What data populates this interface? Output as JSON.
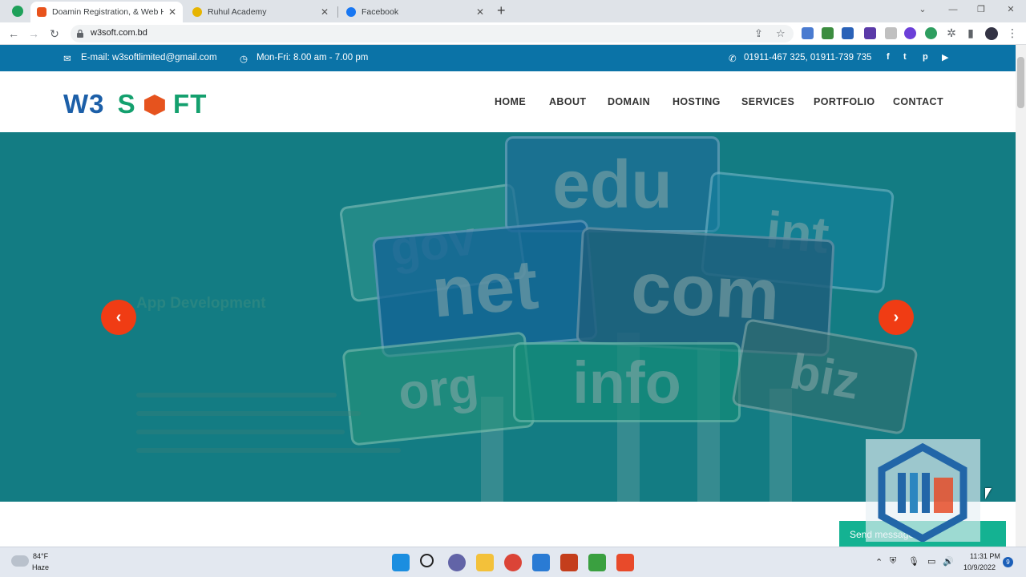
{
  "browser": {
    "tabs": [
      {
        "label": "Doamin Registration, & Web Ho",
        "active": true
      },
      {
        "label": "Ruhul Academy",
        "active": false
      },
      {
        "label": "Facebook",
        "active": false
      }
    ],
    "new_tab": "+",
    "close_glyph": "✕",
    "url": "w3soft.com.bd",
    "window_controls": [
      "⌄",
      "—",
      "❐",
      "✕"
    ]
  },
  "topbar": {
    "email": "E-mail: w3softlimited@gmail.com",
    "hours": "Mon-Fri: 8.00 am - 7.00 pm",
    "phone": "01911-467 325, 01911-739 735",
    "social": [
      "f",
      "t",
      "p",
      "▶"
    ]
  },
  "logo": {
    "part1": "W3",
    "part2": "S",
    "part3": "FT"
  },
  "nav": [
    "HOME",
    "ABOUT",
    "DOMAIN",
    "HOSTING",
    "SERVICES",
    "PORTFOLIO",
    "CONTACT"
  ],
  "hero": {
    "signs": [
      "gov",
      "edu",
      "int",
      "net",
      "com",
      "org",
      "info",
      "biz"
    ],
    "caption": "App Development",
    "prev": "‹",
    "next": "›"
  },
  "chat": {
    "send_message": "Send message"
  },
  "taskbar": {
    "temperature": "84°F",
    "weather": "Haze",
    "time": "11:31 PM",
    "date": "10/9/2022",
    "notifications": "9"
  },
  "colors": {
    "accent_blue": "#0b73a7",
    "hero_teal": "#137c83",
    "arrow_red": "#f03c14",
    "chat_green": "#14b292"
  }
}
